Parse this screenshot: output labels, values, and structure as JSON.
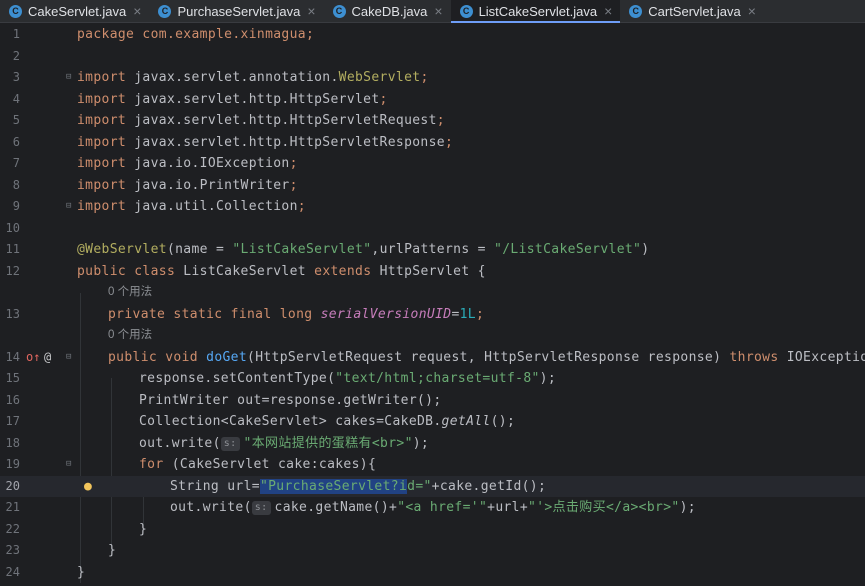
{
  "tabs": [
    {
      "label": "CakeServlet.java",
      "icon": "C",
      "active": false
    },
    {
      "label": "PurchaseServlet.java",
      "icon": "C",
      "active": false
    },
    {
      "label": "CakeDB.java",
      "icon": "C",
      "active": false
    },
    {
      "label": "ListCakeServlet.java",
      "icon": "C",
      "active": true
    },
    {
      "label": "CartServlet.java",
      "icon": "C",
      "active": false
    }
  ],
  "close_glyph": "×",
  "usage_hint": "0 个用法",
  "inlay_hints": {
    "write_param": "s:"
  },
  "gutter_icons": {
    "override": "override-icon",
    "annotation": "@",
    "bulb": "bulb-icon"
  },
  "colors": {
    "keyword": "#cf8e6d",
    "string": "#6aab73",
    "annotation": "#b3ae60",
    "field": "#c77dbb",
    "method": "#56a8f5",
    "number": "#2aacb8",
    "selection": "#214283"
  },
  "code_text": {
    "l1": "package com.example.xinmagua;",
    "l3a": "import",
    "l3b": " javax.servlet.annotation.",
    "l3c": "WebServlet",
    ";": ";",
    "l4a": "import",
    "l4b": " javax.servlet.http.HttpServlet",
    "l5a": "import",
    "l5b": " javax.servlet.http.HttpServletRequest",
    "l6a": "import",
    "l6b": " javax.servlet.http.HttpServletResponse",
    "l7a": "import",
    "l7b": " java.io.IOException",
    "l8a": "import",
    "l8b": " java.io.PrintWriter",
    "l9a": "import",
    "l9b": " java.util.Collection",
    "l11a": "@WebServlet",
    "l11b": "(name = ",
    "l11c": "\"ListCakeServlet\"",
    "l11d": ",urlPatterns = ",
    "l11e": "\"/ListCakeServlet\"",
    "l11f": ")",
    "l12a": "public class",
    "l12b": " ListCakeServlet ",
    "l12c": "extends",
    "l12d": " HttpServlet {",
    "l13a": "private static final long",
    "l13b": "serialVersionUID",
    "l13c": "=",
    "l13d": "1L",
    "l13e": ";",
    "l14a": "public void",
    "l14b": "doGet",
    "l14c": "(HttpServletRequest request, HttpServletResponse response) ",
    "l14d": "throws",
    "l14e": " IOException {",
    "l15a": "response.setContentType(",
    "l15b": "\"text/html;charset=utf-8\"",
    "l15c": ");",
    "l16": "PrintWriter out=response.getWriter();",
    "l17a": "Collection<CakeServlet> cakes=CakeDB.",
    "l17b": "getAll",
    "l17c": "();",
    "l18a": "out.write(",
    "l18b": "\"本网站提供的蛋糕有<br>\"",
    "l18c": ");",
    "l19a": "for",
    "l19b": " (CakeServlet cake:cakes){",
    "l20a": "String url=",
    "l20b": "\"PurchaseServlet?i",
    "l20c": "d=\"",
    "l20d": "+cake.getId();",
    "l21a": "out.write(",
    "l21b": "cake.getName()+",
    "l21c": "\"<a href='\"",
    "l21d": "+url+",
    "l21e": "\"'>点击购买</a><br>\"",
    "l21f": ");",
    "l22": "}",
    "l23": "}",
    "l24": "}"
  }
}
